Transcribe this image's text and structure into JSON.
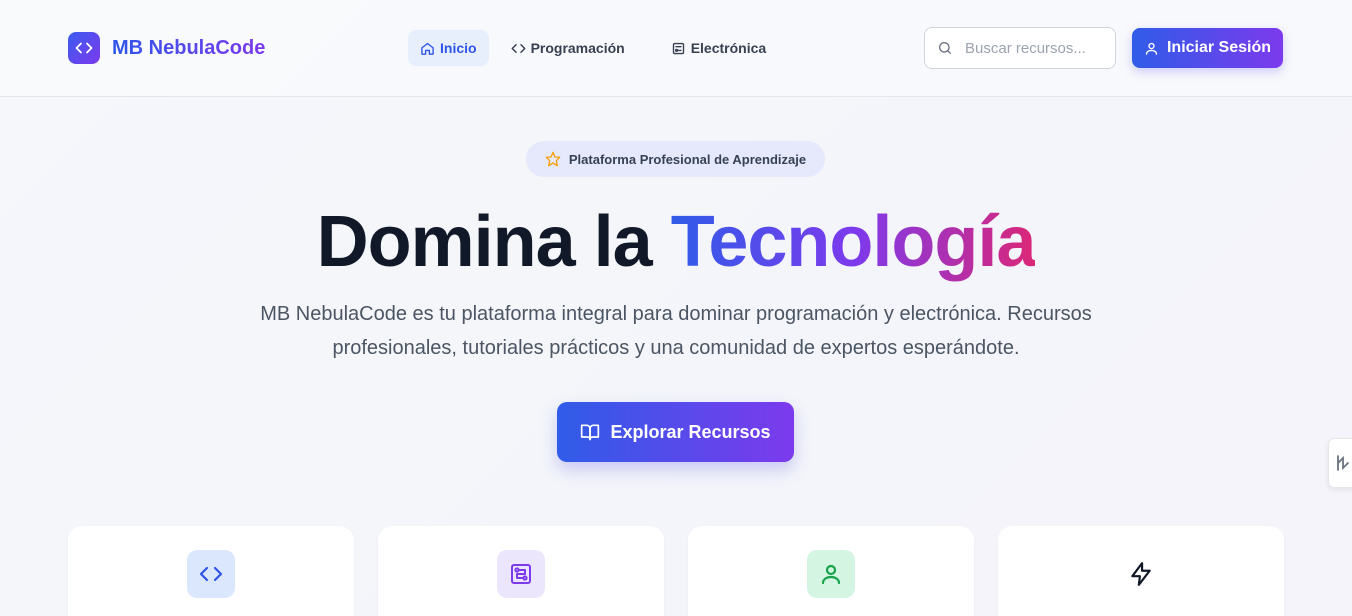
{
  "header": {
    "brand": "MB NebulaCode",
    "nav": [
      {
        "label": "Inicio",
        "icon": "home-icon"
      },
      {
        "label": "Programación",
        "icon": "code-icon"
      },
      {
        "label": "Electrónica",
        "icon": "chip-icon"
      }
    ],
    "search_placeholder": "Buscar recursos...",
    "login_label": "Iniciar Sesión"
  },
  "hero": {
    "badge": "Plataforma Profesional de Aprendizaje",
    "title_plain": "Domina la ",
    "title_highlight": "Tecnología",
    "description": "MB NebulaCode es tu plataforma integral para dominar programación y electrónica. Recursos profesionales, tutoriales prácticos y una comunidad de expertos esperándote.",
    "cta_label": "Explorar Recursos"
  },
  "cards": [
    {
      "icon": "code-icon",
      "bg": "#dbe7fd",
      "color": "#2f55e8"
    },
    {
      "icon": "circuit-icon",
      "bg": "#ece6fd",
      "color": "#7c3aed"
    },
    {
      "icon": "user-icon",
      "bg": "#d5f5e3",
      "color": "#16a34a"
    },
    {
      "icon": "bolt-icon",
      "bg": "#ffffff",
      "color": "#111827"
    }
  ],
  "colors": {
    "primary": "#2f55e8",
    "accent": "#7c3aed",
    "pink": "#db2777"
  }
}
